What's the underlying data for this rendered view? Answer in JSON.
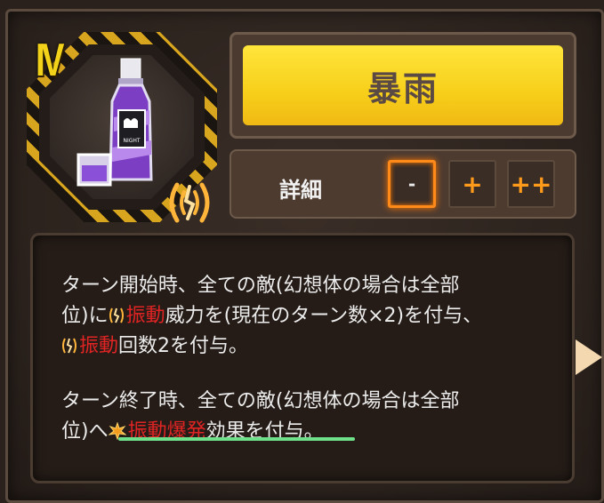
{
  "card": {
    "tier": "IV",
    "name": "暴雨",
    "detail_label": "詳細",
    "levels": [
      {
        "label": "-",
        "active": true
      },
      {
        "label": "+",
        "active": false
      },
      {
        "label": "++",
        "active": false
      }
    ],
    "bottle_label": "NIGHT"
  },
  "description": {
    "line1": "ターン開始時、全ての敵(幻想体の場合は全部",
    "line2_a": "位)に",
    "line2_kw": "振動",
    "line2_b": "威力を(現在のターン数×2)を付与、",
    "line3_kw": "振動",
    "line3_b": "回数2を付与。",
    "line4": "ターン終了時、全ての敵(幻想体の場合は全部",
    "line5_a": "位)へ",
    "line5_kw": "振動爆発",
    "line5_b": "効果を付与。"
  },
  "icons": {
    "vibration": "vibration-icon",
    "burst": "burst-icon",
    "next": "next-arrow-icon"
  },
  "colors": {
    "title_yellow": "#f7cf1a",
    "keyword_red": "#e02424",
    "active_orange": "#ff8a1a",
    "underline_green": "#6fe08a"
  }
}
